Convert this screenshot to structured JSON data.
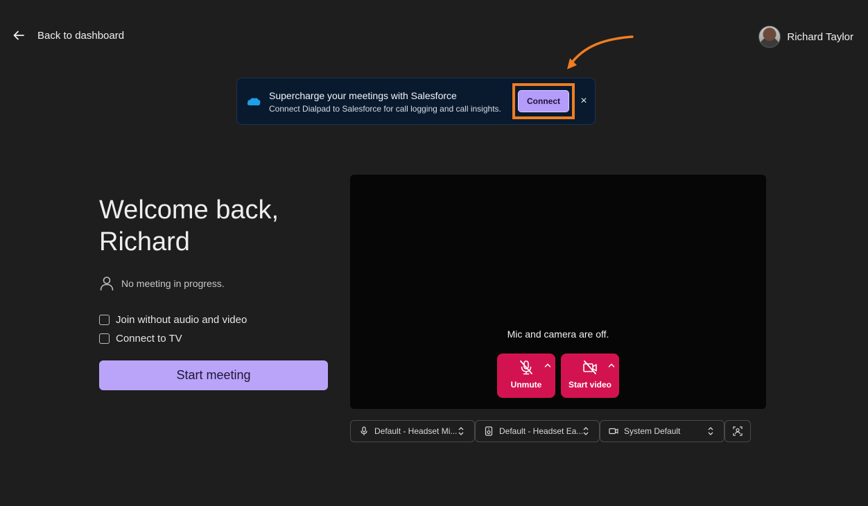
{
  "header": {
    "back_label": "Back to dashboard",
    "user_name": "Richard Taylor"
  },
  "banner": {
    "title": "Supercharge your meetings with Salesforce",
    "subtitle": "Connect Dialpad to Salesforce for call logging and call insights.",
    "connect_label": "Connect",
    "close_glyph": "×",
    "highlight_color": "#f07d21"
  },
  "main": {
    "welcome": "Welcome back, Richard",
    "status": "No meeting in progress.",
    "options": [
      {
        "label": "Join without audio and video",
        "checked": false
      },
      {
        "label": "Connect to TV",
        "checked": false
      }
    ],
    "start_label": "Start meeting"
  },
  "preview": {
    "message": "Mic and camera are off.",
    "unmute_label": "Unmute",
    "start_video_label": "Start video"
  },
  "devices": {
    "microphone": "Default - Headset Mi...",
    "speaker": "Default - Headset Ea...",
    "camera": "System Default"
  },
  "colors": {
    "accent": "#b9a4f9",
    "danger": "#d3134f",
    "background": "#1e1e1e"
  }
}
